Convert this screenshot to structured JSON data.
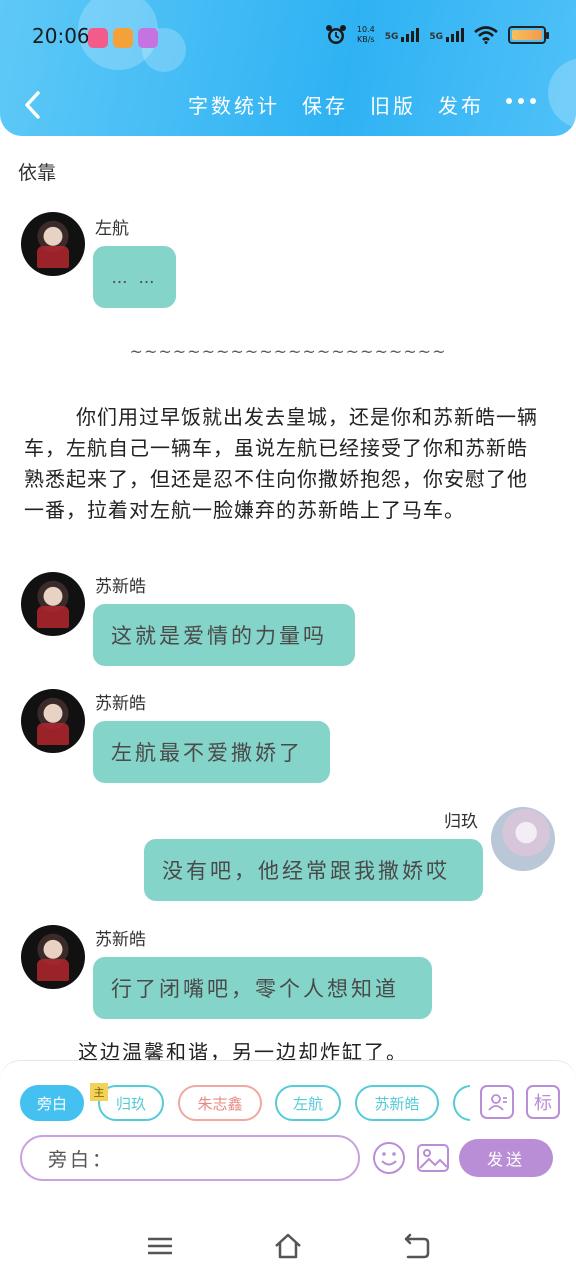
{
  "status_bar": {
    "time": "20:06",
    "net_speed_value": "10.4",
    "net_speed_unit": "KB/s",
    "sim1": "5G",
    "sim2": "5G"
  },
  "header": {
    "actions": [
      "字数统计",
      "保存",
      "旧版",
      "发布"
    ]
  },
  "content": {
    "chapter_title": "依靠",
    "messages": [
      {
        "speaker": "左航",
        "text": "…  …",
        "side": "left"
      },
      {
        "speaker": "苏新皓",
        "text": "这就是爱情的力量吗",
        "side": "left"
      },
      {
        "speaker": "苏新皓",
        "text": "左航最不爱撒娇了",
        "side": "left"
      },
      {
        "speaker": "归玖",
        "text": "没有吧，他经常跟我撒娇哎",
        "side": "right"
      },
      {
        "speaker": "苏新皓",
        "text": "行了闭嘴吧，零个人想知道",
        "side": "left"
      }
    ],
    "separator": "~~~~~~~~~~~~~~~~~~~~~~",
    "narration": "你们用过早饭就出发去皇城，还是你和苏新皓一辆车，左航自己一辆车，虽说左航已经接受了你和苏新皓熟悉起来了，但还是忍不住向你撒娇抱怨，你安慰了他一番，拉着对左航一脸嫌弃的苏新皓上了马车。",
    "narration2": "这边温馨和谐，另一边却炸缸了。"
  },
  "composer": {
    "chips": [
      "旁白",
      "归玖",
      "朱志鑫",
      "左航",
      "苏新皓"
    ],
    "main_tag": "主",
    "tool_label": "标",
    "input_value": "旁白：",
    "send_label": "发送"
  },
  "colors": {
    "header": "#2fb2f3",
    "bubble": "#84d4c9",
    "accent_purple": "#b98ed6",
    "chip_teal": "#55cbd6"
  }
}
